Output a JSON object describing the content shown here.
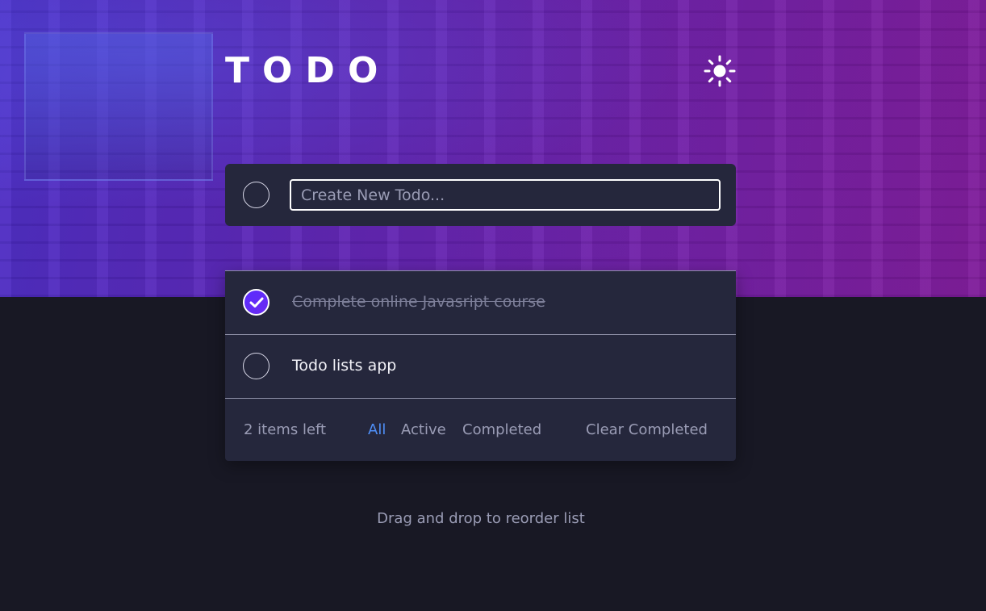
{
  "app": {
    "title": "TODO"
  },
  "theme_toggle": {
    "icon": "sun-icon"
  },
  "new_todo": {
    "placeholder": "Create New Todo...",
    "value": ""
  },
  "todos": [
    {
      "text": "Complete online Javasript course",
      "completed": true
    },
    {
      "text": "Todo lists app",
      "completed": false
    }
  ],
  "footer": {
    "items_left": "2 items left",
    "filters": [
      "All",
      "Active",
      "Completed"
    ],
    "active_filter": "All",
    "clear_label": "Clear Completed"
  },
  "hint": "Drag and drop to reorder list",
  "colors": {
    "background": "#181824",
    "card": "#25273c",
    "accent": "#4f8ff7",
    "check": "#5b2cff"
  }
}
